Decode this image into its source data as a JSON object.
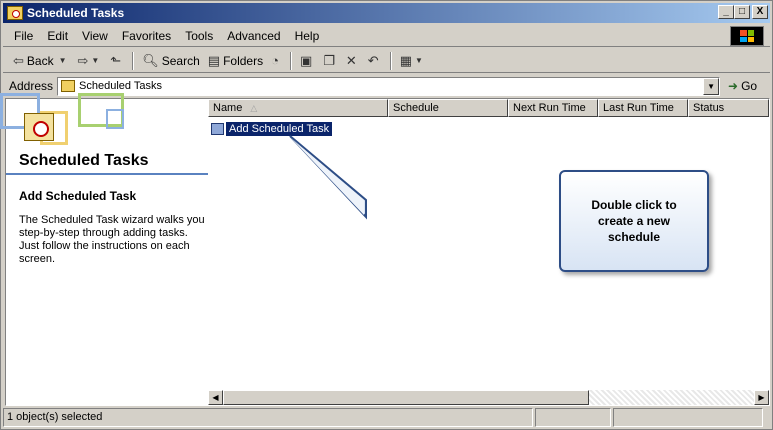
{
  "window": {
    "title": "Scheduled Tasks",
    "controls": [
      "_",
      "□",
      "X"
    ]
  },
  "menu": [
    {
      "label": "File"
    },
    {
      "label": "Edit"
    },
    {
      "label": "View"
    },
    {
      "label": "Favorites"
    },
    {
      "label": "Tools"
    },
    {
      "label": "Advanced"
    },
    {
      "label": "Help"
    }
  ],
  "toolbar": {
    "back_label": "Back",
    "search_label": "Search",
    "folders_label": "Folders"
  },
  "address": {
    "label": "Address",
    "value": "Scheduled Tasks",
    "go_label": "Go"
  },
  "left_panel": {
    "title": "Scheduled Tasks",
    "subtitle": "Add Scheduled Task",
    "description": "The Scheduled Task wizard walks you step-by-step through adding tasks. Just follow the instructions on each screen."
  },
  "list": {
    "columns": [
      "Name",
      "Schedule",
      "Next Run Time",
      "Last Run Time",
      "Status"
    ],
    "items": [
      {
        "name": "Add Scheduled Task",
        "icon": "scheduled-task-icon"
      }
    ]
  },
  "callout": {
    "text": "Double click to create a new schedule"
  },
  "status": {
    "text": "1 object(s) selected"
  },
  "colors": {
    "titlebar": "#0a246a",
    "selection": "#0a246a",
    "callout_border": "#2d4d86"
  }
}
